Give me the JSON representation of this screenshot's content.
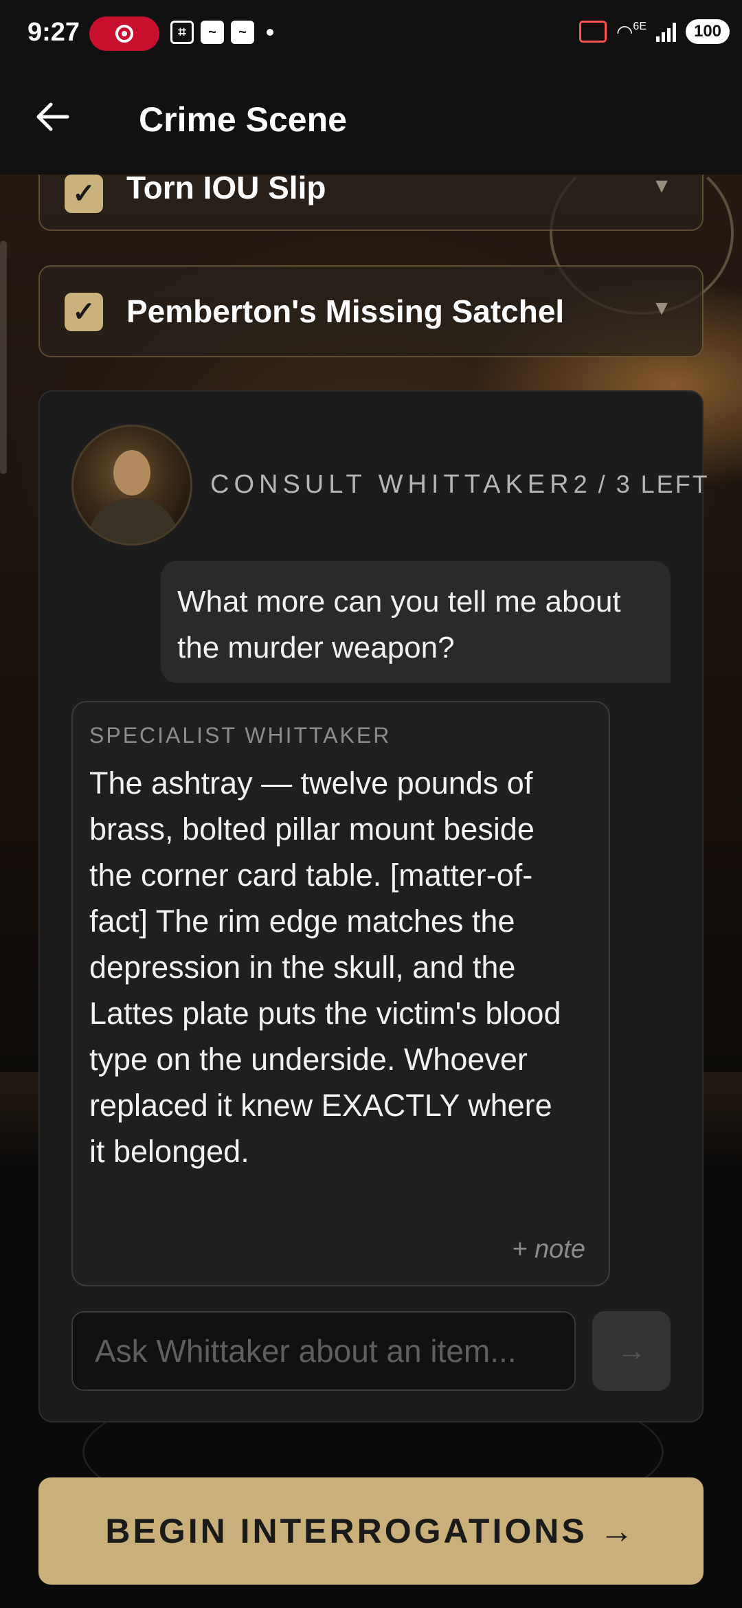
{
  "status_bar": {
    "time": "9:27",
    "network_label": "6E",
    "battery": "100"
  },
  "header": {
    "title": "Crime Scene"
  },
  "evidence": [
    {
      "label": "Torn IOU Slip",
      "checked": true
    },
    {
      "label": "Pemberton's Missing Satchel",
      "checked": true
    }
  ],
  "consult": {
    "heading": "CONSULT WHITTAKER",
    "remaining": "2 / 3 LEFT",
    "user_message": "What more can you tell me about the murder weapon?",
    "specialist_name": "SPECIALIST WHITTAKER",
    "specialist_message": "The ashtray — twelve pounds of brass, bolted pillar mount beside the corner card table. [matter-of-fact] The rim edge matches the depression in the skull, and the Lattes plate puts the victim's blood type on the underside. Whoever replaced it knew EXACTLY where it belonged.",
    "note_label": "+ note",
    "input_placeholder": "Ask Whittaker about an item...",
    "send_icon": "→"
  },
  "cta": {
    "label": "BEGIN INTERROGATIONS →"
  },
  "colors": {
    "accent": "#c9b07a",
    "panel": "#1c1c1c",
    "checkbox": "#c9b27c"
  }
}
